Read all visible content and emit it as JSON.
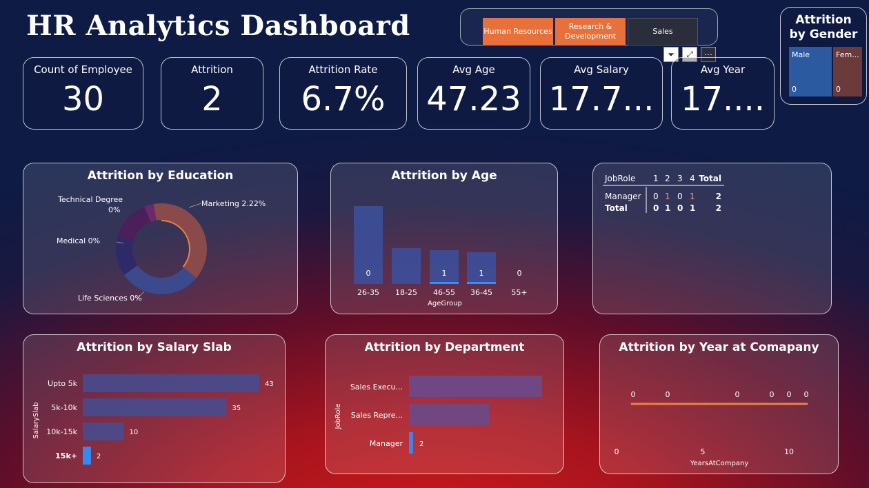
{
  "title": "HR Analytics Dashboard",
  "slicer": {
    "items": [
      "Human Resources",
      "Research & Development",
      "Sales"
    ]
  },
  "gender": {
    "title": "Attrition by Gender",
    "male_label": "Male",
    "male_value": "0",
    "female_label": "Fem...",
    "female_value": "0"
  },
  "kpis": [
    {
      "label": "Count of Employee",
      "value": "30"
    },
    {
      "label": "Attrition",
      "value": "2"
    },
    {
      "label": "Attrition Rate",
      "value": "6.7%"
    },
    {
      "label": "Avg Age",
      "value": "47.23"
    },
    {
      "label": "Avg Salary",
      "value": "17.7..."
    },
    {
      "label": "Avg Year",
      "value": "17...."
    }
  ],
  "education": {
    "title": "Attrition by Education",
    "labels": [
      "Technical Degree",
      "0%",
      "Marketing 2.22%",
      "Medical 0%",
      "Life Sciences 0%"
    ]
  },
  "age": {
    "title": "Attrition by Age",
    "xlabel": "AgeGroup",
    "categories": [
      "26-35",
      "18-25",
      "46-55",
      "36-45",
      "55+"
    ],
    "labels": [
      "0",
      "",
      "1",
      "1",
      "0"
    ]
  },
  "matrix": {
    "headers": [
      "JobRole",
      "1",
      "2",
      "3",
      "4",
      "Total"
    ],
    "rows": [
      [
        "Manager",
        "0",
        "1",
        "0",
        "1",
        "2"
      ],
      [
        "Total",
        "0",
        "1",
        "0",
        "1",
        "2"
      ]
    ]
  },
  "salary": {
    "title": "Attrition by Salary Slab",
    "ylabel": "SalarySlab",
    "categories": [
      "Upto 5k",
      "5k-10k",
      "10k-15k",
      "15k+"
    ],
    "values": [
      "43",
      "35",
      "10",
      "2"
    ]
  },
  "department": {
    "title": "Attrition by Department",
    "ylabel": "JobRole",
    "categories": [
      "Sales Execu...",
      "Sales Repre...",
      "Manager"
    ],
    "values": [
      "",
      "",
      "2"
    ]
  },
  "years": {
    "title": "Attrition by Year at Comapany",
    "xlabel": "YearsAtCompany",
    "ticks": [
      "0",
      "5",
      "10"
    ],
    "point_labels": [
      "0",
      "0",
      "0",
      "0",
      "0",
      "0"
    ]
  },
  "chart_data": [
    {
      "type": "pie",
      "title": "Attrition by Education",
      "categories": [
        "Marketing",
        "Life Sciences",
        "Medical",
        "Technical Degree"
      ],
      "values": [
        2.22,
        0,
        0,
        0
      ]
    },
    {
      "type": "bar",
      "title": "Attrition by Age",
      "xlabel": "AgeGroup",
      "categories": [
        "26-35",
        "18-25",
        "46-55",
        "36-45",
        "55+"
      ],
      "values": [
        0,
        0,
        1,
        1,
        0
      ]
    },
    {
      "type": "bar",
      "title": "Attrition by Salary Slab",
      "ylabel": "SalarySlab",
      "categories": [
        "Upto 5k",
        "5k-10k",
        "10k-15k",
        "15k+"
      ],
      "values": [
        43,
        35,
        10,
        2
      ]
    },
    {
      "type": "bar",
      "title": "Attrition by Department",
      "ylabel": "JobRole",
      "categories": [
        "Sales Execu...",
        "Sales Repre...",
        "Manager"
      ],
      "values": [
        null,
        null,
        2
      ]
    },
    {
      "type": "line",
      "title": "Attrition by Year at Comapany",
      "xlabel": "YearsAtCompany",
      "xlim": [
        0,
        10
      ],
      "values": [
        0,
        0,
        0,
        0,
        0,
        0
      ]
    }
  ]
}
